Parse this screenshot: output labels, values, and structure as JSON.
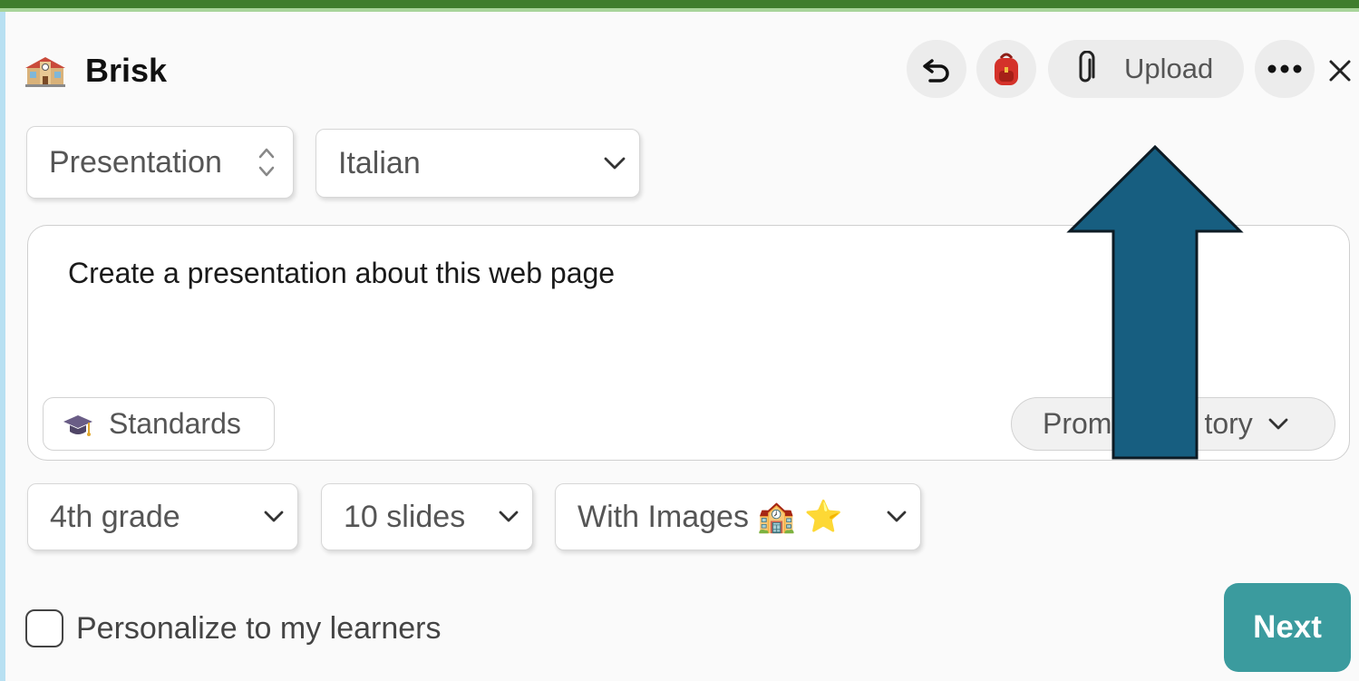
{
  "brand": {
    "name": "Brisk",
    "logo_icon": "school-building-icon"
  },
  "toolbar": {
    "undo_icon": "undo-icon",
    "backpack_icon": "backpack-icon",
    "upload_label": "Upload",
    "more_icon": "more-icon",
    "close_icon": "close-icon"
  },
  "selects": {
    "output_type": "Presentation",
    "language": "Italian",
    "grade": "4th grade",
    "slides": "10 slides",
    "images": "With Images 🏫 ⭐"
  },
  "prompt": {
    "text": "Create a presentation about this web page",
    "standards_label": "Standards",
    "history_label_before": "Prom",
    "history_label_after": "tory"
  },
  "personalize": {
    "label": "Personalize to my learners",
    "checked": false
  },
  "next_label": "Next",
  "colors": {
    "accent": "#3b9b9e",
    "arrow_fill": "#175e80",
    "top_bar": "#3f7d2d",
    "left_edge": "#b8e0f2"
  }
}
